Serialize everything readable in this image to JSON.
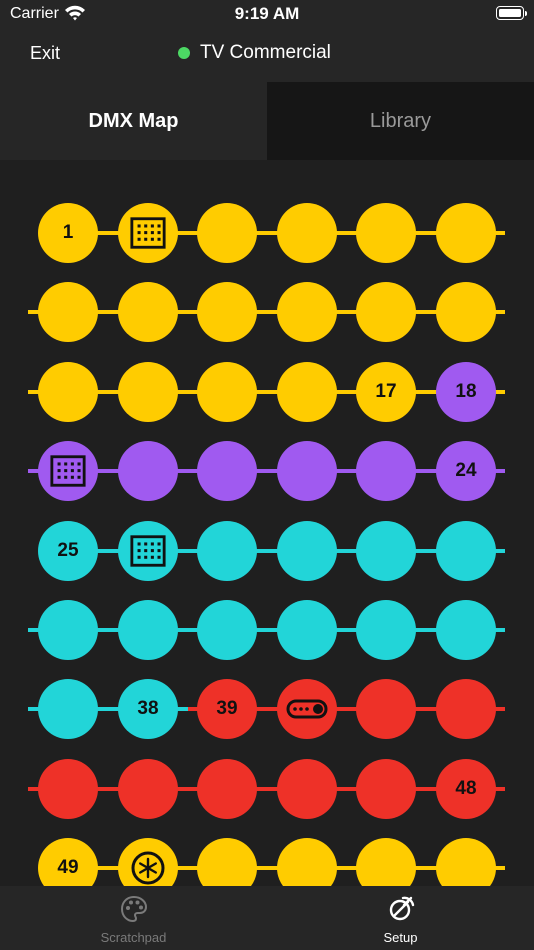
{
  "status_bar": {
    "carrier": "Carrier",
    "time": "9:19 AM"
  },
  "nav": {
    "exit_label": "Exit",
    "title": "TV Commercial",
    "status_color": "#4cd964"
  },
  "tabs": [
    {
      "label": "DMX Map",
      "active": true
    },
    {
      "label": "Library",
      "active": false
    }
  ],
  "colors": {
    "yellow": "#ffcc00",
    "purple": "#a05af0",
    "cyan": "#22d5d8",
    "red": "#ee3128"
  },
  "dmx_rows": [
    {
      "color": "yellow",
      "line_left": false,
      "cells": [
        {
          "label": "1"
        },
        {
          "icon": "grid"
        },
        {
          "label": ""
        },
        {
          "label": ""
        },
        {
          "label": ""
        },
        {
          "label": ""
        }
      ]
    },
    {
      "color": "yellow",
      "line_left": true,
      "cells": [
        {
          "label": ""
        },
        {
          "label": ""
        },
        {
          "label": ""
        },
        {
          "label": ""
        },
        {
          "label": ""
        },
        {
          "label": ""
        }
      ]
    },
    {
      "color": "yellow",
      "line_left": true,
      "cells": [
        {
          "label": ""
        },
        {
          "label": ""
        },
        {
          "label": ""
        },
        {
          "label": ""
        },
        {
          "label": "17"
        },
        {
          "label": "18",
          "color": "purple"
        }
      ]
    },
    {
      "color": "purple",
      "line_left": true,
      "cells": [
        {
          "icon": "grid"
        },
        {
          "label": ""
        },
        {
          "label": ""
        },
        {
          "label": ""
        },
        {
          "label": ""
        },
        {
          "label": "24"
        }
      ]
    },
    {
      "color": "cyan",
      "line_left": false,
      "cells": [
        {
          "label": "25"
        },
        {
          "icon": "grid"
        },
        {
          "label": ""
        },
        {
          "label": ""
        },
        {
          "label": ""
        },
        {
          "label": ""
        }
      ]
    },
    {
      "color": "cyan",
      "line_left": true,
      "cells": [
        {
          "label": ""
        },
        {
          "label": ""
        },
        {
          "label": ""
        },
        {
          "label": ""
        },
        {
          "label": ""
        },
        {
          "label": ""
        }
      ]
    },
    {
      "color": "cyan",
      "line_left": true,
      "right_color": "red",
      "split_after": 1,
      "cells": [
        {
          "label": ""
        },
        {
          "label": "38"
        },
        {
          "label": "39",
          "color": "red"
        },
        {
          "icon": "toggle",
          "color": "red"
        },
        {
          "label": "",
          "color": "red"
        },
        {
          "label": "",
          "color": "red"
        }
      ]
    },
    {
      "color": "red",
      "line_left": true,
      "cells": [
        {
          "label": ""
        },
        {
          "label": ""
        },
        {
          "label": ""
        },
        {
          "label": ""
        },
        {
          "label": ""
        },
        {
          "label": "48"
        }
      ]
    },
    {
      "color": "yellow",
      "line_left": false,
      "cells": [
        {
          "label": "49"
        },
        {
          "icon": "wheel"
        },
        {
          "label": ""
        },
        {
          "label": ""
        },
        {
          "label": ""
        },
        {
          "label": ""
        }
      ]
    }
  ],
  "tabbar": [
    {
      "label": "Scratchpad",
      "icon": "palette-icon",
      "active": false
    },
    {
      "label": "Setup",
      "icon": "setup-icon",
      "active": true
    }
  ]
}
